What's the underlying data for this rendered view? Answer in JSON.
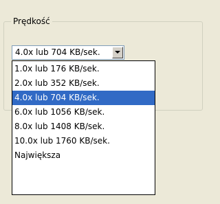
{
  "speed_group": {
    "title": "Prędkość",
    "selected_value": "4.0x lub 704 KB/sek.",
    "options": [
      "1.0x lub 176 KB/sek.",
      "2.0x lub 352 KB/sek.",
      "4.0x lub 704 KB/sek.",
      "6.0x lub 1056 KB/sek.",
      "8.0x lub 1408 KB/sek.",
      "10.0x lub 1760 KB/sek.",
      "Największa"
    ],
    "highlighted_index": 2
  },
  "colors": {
    "dialog_background": "#ece9d8",
    "selection_background": "#316ac5",
    "selection_text": "#ffffff",
    "combo_border": "#7f9db9"
  },
  "icons": {
    "combo_button": "chevron-down-icon"
  }
}
